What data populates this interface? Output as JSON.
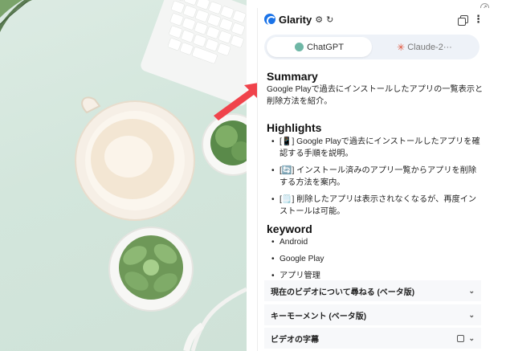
{
  "panel": {
    "brand": "Glarity",
    "header_icons": [
      "gear-icon",
      "refresh-icon",
      "copy-icon",
      "more-vertical-icon"
    ],
    "tabs": [
      {
        "label": "ChatGPT",
        "active": true
      },
      {
        "label": "Claude-2···",
        "active": false
      }
    ],
    "summary": {
      "heading": "Summary",
      "text": "Google Playで過去にインストールしたアプリの一覧表示と削除方法を紹介。"
    },
    "highlights": {
      "heading": "Highlights",
      "items": [
        "[📱] Google Playで過去にインストールしたアプリを確認する手順を説明。",
        "[🔄] インストール済みのアプリ一覧からアプリを削除する方法を案内。",
        "[🗒️] 削除したアプリは表示されなくなるが、再度インストールは可能。"
      ]
    },
    "keyword": {
      "heading": "keyword",
      "items": [
        "Android",
        "Google Play",
        "アプリ管理"
      ]
    },
    "accordions": [
      {
        "label": "現在のビデオについて尋ねる (ベータ版)"
      },
      {
        "label": "キーモーメント (ベータ版)"
      },
      {
        "label": "ビデオの字幕"
      }
    ]
  },
  "colors": {
    "accent": "#1a73e8",
    "tab_bg": "#eef2f8",
    "arrow": "#f0434b",
    "photo_bg": "#d3e6dc"
  }
}
